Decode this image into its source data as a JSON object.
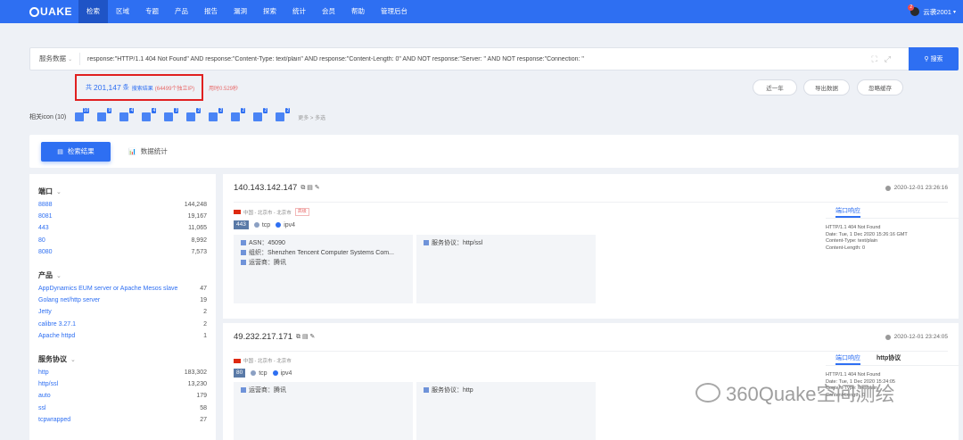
{
  "nav": {
    "logo": "UAKE",
    "items": [
      "检索",
      "区域",
      "专题",
      "产品",
      "报告",
      "漏洞",
      "探索",
      "统计",
      "会员",
      "帮助",
      "管理后台"
    ],
    "active": 0,
    "user": "云袭2001",
    "badge": "2"
  },
  "search": {
    "scope": "服务数据",
    "query": "response:\"HTTP/1.1 404 Not Found\" AND response:\"Content-Type: text/plain\" AND response:\"Content-Length: 0\" AND NOT response:\"Server: \" AND NOT response:\"Connection: \"",
    "button": "搜索"
  },
  "summary": {
    "prefix": "共",
    "count": "201,147",
    "unit": "条",
    "label": "搜索结果",
    "ips": "(64499个独立IP)",
    "time": "用时0.529秒"
  },
  "actions": {
    "year": "近一年",
    "export": "导出数据",
    "cache": "忽略缓存"
  },
  "related": {
    "title": "相关icon (10)",
    "counts": [
      "10",
      "9",
      "4",
      "4",
      "3",
      "2",
      "2",
      "2",
      "2",
      "2"
    ],
    "more": "更多 > 多选"
  },
  "tabs": {
    "results": "检索结果",
    "stats": "数据统计"
  },
  "sidebar": {
    "ports": {
      "title": "端口",
      "rows": [
        [
          "8888",
          "144,248"
        ],
        [
          "8081",
          "19,167"
        ],
        [
          "443",
          "11,065"
        ],
        [
          "80",
          "8,992"
        ],
        [
          "8080",
          "7,573"
        ]
      ]
    },
    "products": {
      "title": "产品",
      "rows": [
        [
          "AppDynamics EUM server or Apache Mesos slave",
          "47"
        ],
        [
          "Golang net/http server",
          "19"
        ],
        [
          "Jetty",
          "2"
        ],
        [
          "calibre 3.27.1",
          "2"
        ],
        [
          "Apache httpd",
          "1"
        ]
      ]
    },
    "services": {
      "title": "服务协议",
      "rows": [
        [
          "http",
          "183,302"
        ],
        [
          "http/ssl",
          "13,230"
        ],
        [
          "auto",
          "179"
        ],
        [
          "ssl",
          "58"
        ],
        [
          "tcpwrapped",
          "27"
        ]
      ]
    }
  },
  "results": [
    {
      "ip": "140.143.142.147",
      "time": "2020-12-01 23:26:16",
      "loc": "中国 - 北京市 - 北京市",
      "tag": "高级",
      "port": "443",
      "tcp": "tcp",
      "ipv": "ipv4",
      "asn": "ASN：45090",
      "org": "组织：Shenzhen Tencent Computer Systems Com...",
      "isp": "运营商：腾讯",
      "service": "服务协议：http/ssl",
      "resp_tab": "端口响应",
      "resp": "HTTP/1.1 404 Not Found\nDate: Tue, 1 Dec 2020 15:26:16 GMT\nContent-Type: text/plain\nContent-Length: 0"
    },
    {
      "ip": "49.232.217.171",
      "time": "2020-12-01 23:24:05",
      "loc": "中国 - 北京市 - 北京市",
      "tag": "",
      "port": "80",
      "tcp": "tcp",
      "ipv": "ipv4",
      "isp": "运营商：腾讯",
      "service": "服务协议：http",
      "resp_tab": "端口响应",
      "resp_tab2": "http协议",
      "resp": "HTTP/1.1 404 Not Found\nDate: Tue, 1 Dec 2020 15:24:05\nContent-Type: text/plain\nContent-Length: 0"
    }
  ],
  "watermark": "360Quake空间测绘"
}
